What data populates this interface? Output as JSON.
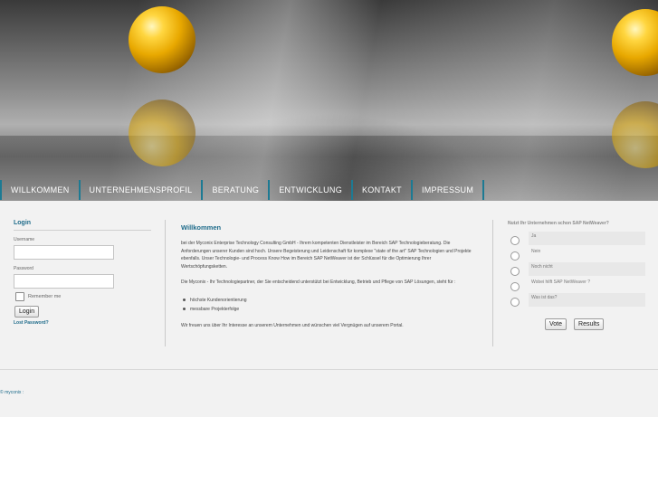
{
  "nav": {
    "items": [
      "WILLKOMMEN",
      "UNTERNEHMENSPROFIL",
      "BERATUNG",
      "ENTWICKLUNG",
      "KONTAKT",
      "IMPRESSUM"
    ]
  },
  "login": {
    "title": "Login",
    "username_label": "Username",
    "username_value": "",
    "password_label": "Password",
    "password_value": "",
    "remember_label": "Remember me",
    "login_button": "Login",
    "lost_password": "Lost Password?"
  },
  "main": {
    "title": "Willkommen",
    "para1": "bei der Myconix Enterprise Technology Consulting GmbH - Ihrem kompetenten Dienstleister im Bereich SAP Technologieberatung. Die Anforderungen unserer Kunden sind hoch. Unsere Begeisterung und Leidenschaft für komplexe \"state of the art\" SAP Technologien und Projekte ebenfalls. Unser Technologie- und Process Know How im Bereich SAP NetWeaver ist der Schlüssel für die Optimierung Ihrer Wertschöpfungsketten.",
    "para2": "Die Myconix - Ihr Technologiepartner, der Sie entscheidend unterstützt bei Entwicklung, Betrieb und Pflege von SAP Lösungen, steht für :",
    "bullets": [
      "höchste Kundenorientierung",
      "messbare Projekterfolge"
    ],
    "para3": "Wir freuen uns über Ihr Interesse an unserem Unternehmen und wünschen viel Vergnügen auf unserem Portal."
  },
  "poll": {
    "question": "Nutzt Ihr Unternehmen schon SAP NetWeaver?",
    "options": [
      "Ja",
      "Nein",
      "Noch nicht",
      "Wobei hilft SAP NetWeaver ?",
      "Was ist das?"
    ],
    "vote_button": "Vote",
    "results_button": "Results"
  },
  "footer": {
    "text": "© myconix :"
  },
  "colors": {
    "accent": "#1e6b8a",
    "nav_separator": "#1d7a93",
    "content_bg": "#f2f2f2"
  }
}
